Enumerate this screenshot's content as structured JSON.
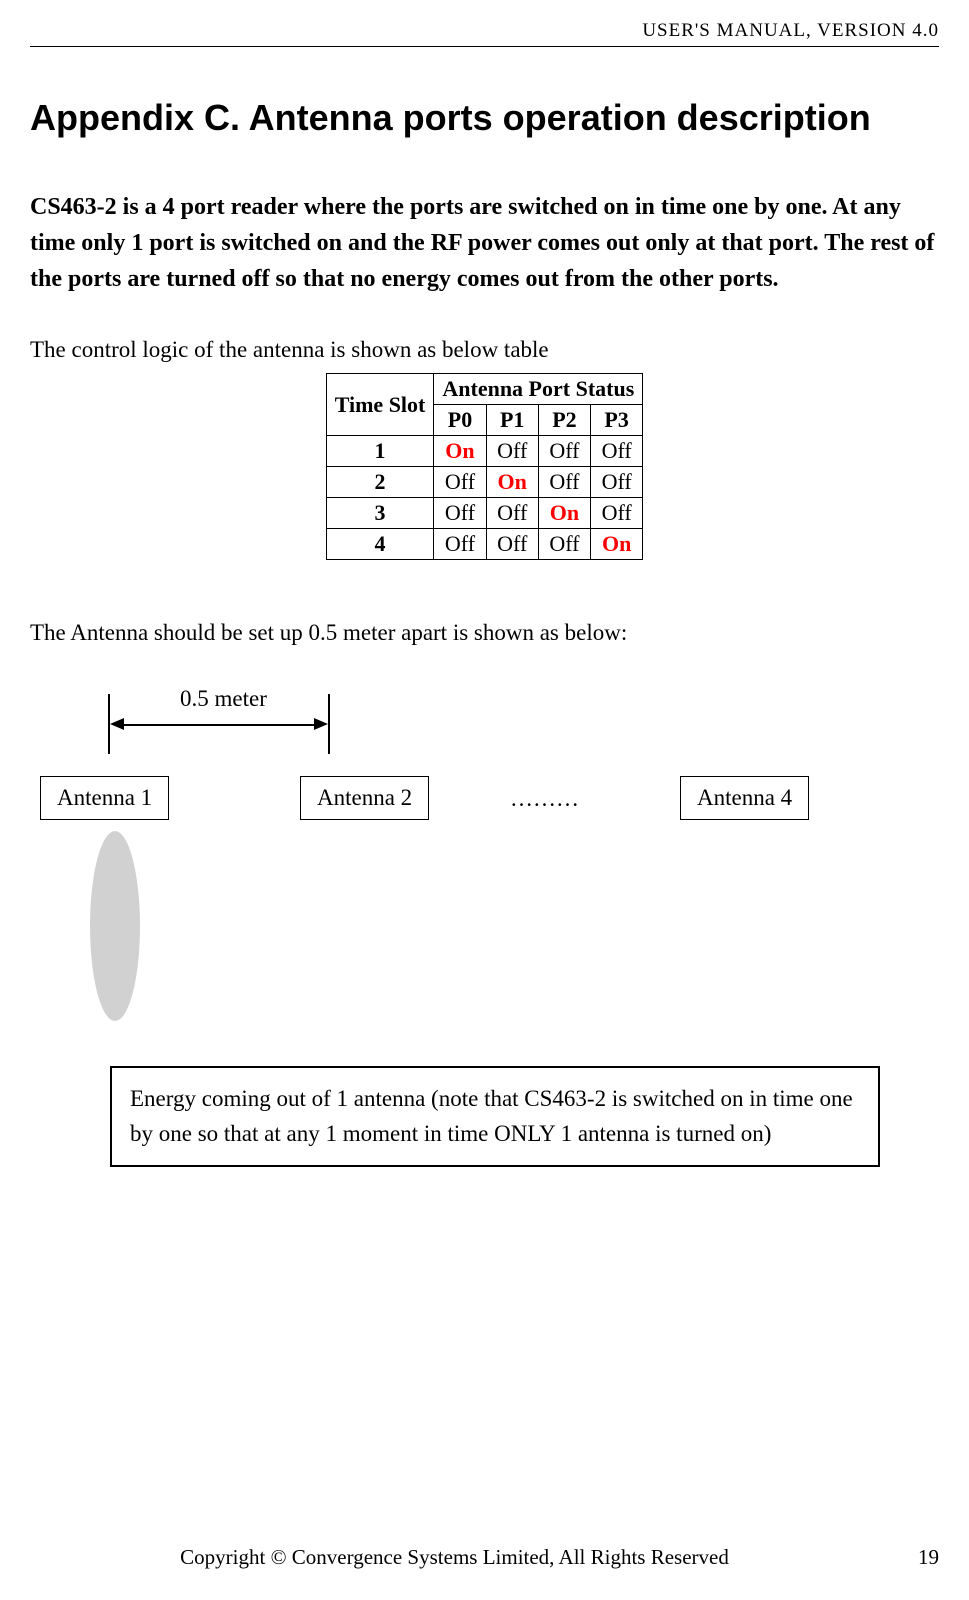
{
  "header": {
    "text": "USER'S  MANUAL,  VERSION  4.0"
  },
  "title": "Appendix C. Antenna ports operation description",
  "intro": "CS463-2 is a 4 port reader where the ports are switched on in time one by one.    At any time only 1 port is switched on and the RF power comes out only at that port.    The rest of the ports are turned off so that no energy comes out from the other ports.",
  "controlText": "The control logic of the antenna is shown as below table",
  "table": {
    "timeSlotHeader": "Time Slot",
    "statusHeader": "Antenna Port Status",
    "ports": [
      "P0",
      "P1",
      "P2",
      "P3"
    ],
    "rows": [
      {
        "slot": "1",
        "cells": [
          "On",
          "Off",
          "Off",
          "Off"
        ]
      },
      {
        "slot": "2",
        "cells": [
          "Off",
          "On",
          "Off",
          "Off"
        ]
      },
      {
        "slot": "3",
        "cells": [
          "Off",
          "Off",
          "On",
          "Off"
        ]
      },
      {
        "slot": "4",
        "cells": [
          "Off",
          "Off",
          "Off",
          "On"
        ]
      }
    ]
  },
  "setupText": "The Antenna should be set up 0.5 meter apart is shown as below:",
  "diagram": {
    "distanceLabel": "0.5 meter",
    "antenna1": "Antenna 1",
    "antenna2": "Antenna 2",
    "dots": "………",
    "antenna4": "Antenna 4",
    "energyNote": "Energy coming out of 1 antenna (note that CS463-2 is switched on in time one by one so that at any 1 moment in time ONLY 1 antenna is turned on)"
  },
  "footer": {
    "copyright": "Copyright © Convergence Systems Limited, All Rights Reserved",
    "pageNum": "19"
  }
}
